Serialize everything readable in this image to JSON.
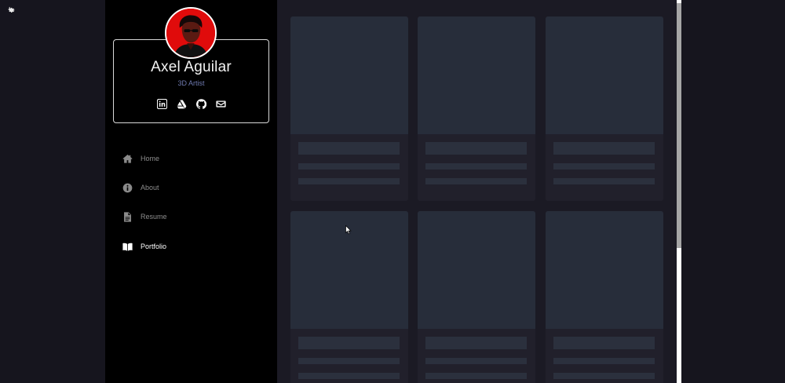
{
  "profile": {
    "name": "Axel Aguilar",
    "role": "3D Artist",
    "social": [
      {
        "icon": "linkedin-icon"
      },
      {
        "icon": "artstation-icon"
      },
      {
        "icon": "github-icon"
      },
      {
        "icon": "mail-icon"
      }
    ]
  },
  "nav": {
    "items": [
      {
        "label": "Home",
        "icon": "home-icon",
        "active": false
      },
      {
        "label": "About",
        "icon": "info-icon",
        "active": false
      },
      {
        "label": "Resume",
        "icon": "document-icon",
        "active": false
      },
      {
        "label": "Portfolio",
        "icon": "book-open-icon",
        "active": true
      }
    ]
  },
  "colors": {
    "page_bg": "#16151e",
    "sidebar_bg": "#000000",
    "avatar_bg": "#e00b0b",
    "role_text": "#6f7ab0",
    "card_bg": "#21202b",
    "card_thumb": "#272d3a"
  },
  "portfolio": {
    "loading": true,
    "card_count": 6
  }
}
